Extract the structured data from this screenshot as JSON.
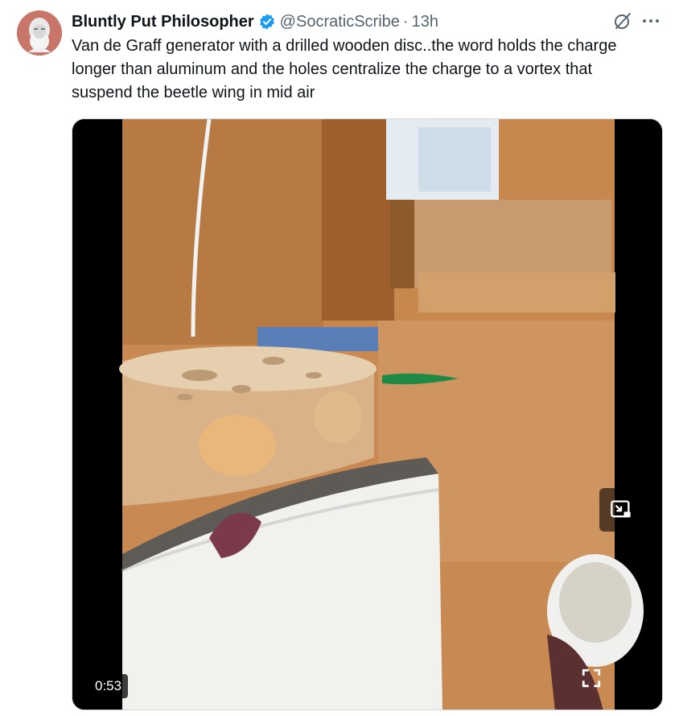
{
  "author": {
    "display_name": "Bluntly Put Philosopher",
    "handle": "@SocraticScribe",
    "separator": "·",
    "time": "13h"
  },
  "tweet": {
    "text": "Van de Graff generator with a drilled wooden disc..the word holds the charge longer than aluminum and the holes centralize the charge to a vortex that suspend the beetle wing in mid air"
  },
  "media": {
    "duration": "0:53"
  },
  "icons": {
    "verified": "verified-badge-icon",
    "grok": "grok-icon",
    "more": "more-icon",
    "pip": "picture-in-picture-icon",
    "fullscreen": "fullscreen-icon"
  },
  "colors": {
    "verified_blue": "#1d9bf0",
    "secondary_text": "#536471",
    "primary_text": "#0f1419"
  }
}
